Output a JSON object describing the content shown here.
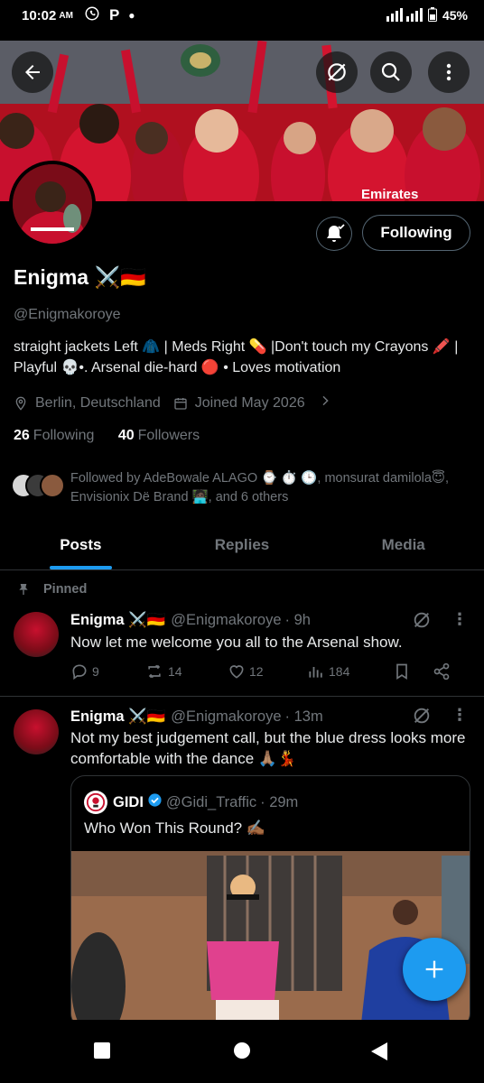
{
  "status_bar": {
    "time": "10:02",
    "ampm": "AM",
    "app_icons": [
      "whatsapp-icon",
      "p-icon",
      "dot"
    ],
    "battery": "45%"
  },
  "profile": {
    "name": "Enigma ⚔️🇩🇪",
    "handle": "@Enigmakoroye",
    "bio": "straight jackets Left 🧥 | Meds Right 💊 |Don't touch my Crayons 🖍️ | Playful 💀•. Arsenal die-hard 🔴 • Loves motivation",
    "location": "Berlin, Deutschland",
    "joined": "Joined May 2026",
    "following_count": "26",
    "following_label": "Following",
    "followers_count": "40",
    "followers_label": "Followers",
    "follow_button": "Following",
    "followed_by": "Followed by AdeBowale ALAGO ⌚ ⏱️ 🕒, monsurat damilola😇, Envisionix Dë Brand 🧑🏿‍💻, and 6 others"
  },
  "tabs": [
    {
      "label": "Posts",
      "active": true
    },
    {
      "label": "Replies",
      "active": false
    },
    {
      "label": "Media",
      "active": false
    }
  ],
  "pinned_label": "Pinned",
  "posts": [
    {
      "name": "Enigma ⚔️🇩🇪",
      "handle": "@Enigmakoroye",
      "time": "· 9h",
      "text": "Now let me welcome you all to the Arsenal show.",
      "replies": "9",
      "reposts": "14",
      "likes": "12",
      "views": "184"
    },
    {
      "name": "Enigma ⚔️🇩🇪",
      "handle": "@Enigmakoroye",
      "time": "· 13m",
      "text": "Not my best judgement call, but the blue dress looks more comfortable with the dance 🙏🏽💃",
      "quote": {
        "name": "GIDI",
        "handle": "@Gidi_Traffic",
        "time": "· 29m",
        "text": "Who Won This Round? ✍🏾"
      }
    }
  ],
  "colors": {
    "accent": "#1d9bf0",
    "background": "#000000",
    "muted": "#71767b",
    "arsenal_red": "#c8102e"
  }
}
